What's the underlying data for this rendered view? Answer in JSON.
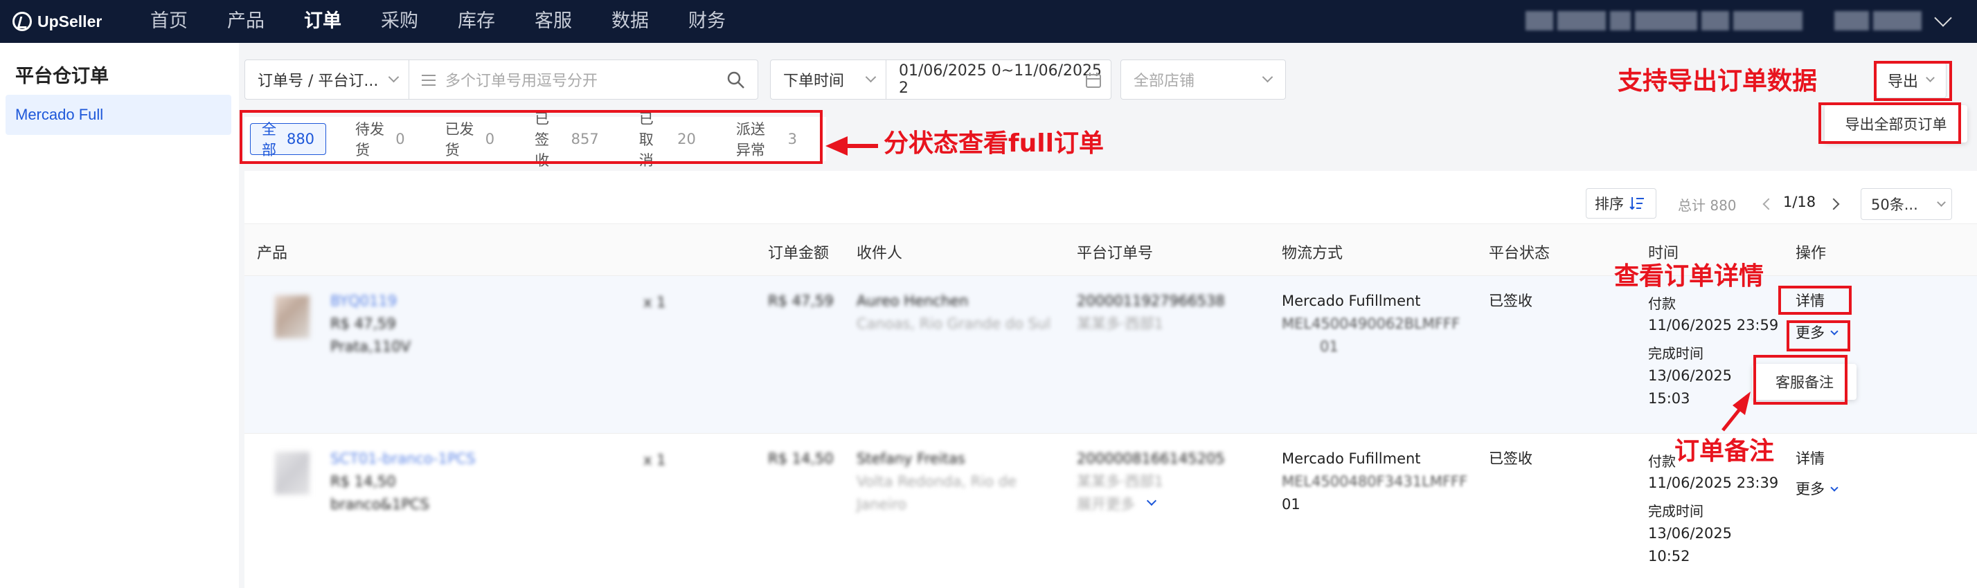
{
  "app": {
    "logo": "UpSeller",
    "menu": [
      "首页",
      "产品",
      "订单",
      "采购",
      "库存",
      "客服",
      "数据",
      "财务"
    ],
    "active": "订单"
  },
  "sidebar": {
    "title": "平台仓订单",
    "item": "Mercado Full"
  },
  "filters": {
    "order_type": "订单号 / 平台订...",
    "order_placeholder": "多个订单号用逗号分开",
    "time_type": "下单时间",
    "date_range": "01/06/2025 0~11/06/2025 2",
    "store_placeholder": "全部店铺",
    "export": "导出",
    "export_all": "导出全部页订单"
  },
  "tabs": [
    {
      "label": "全部",
      "count": "880"
    },
    {
      "label": "待发货",
      "count": "0"
    },
    {
      "label": "已发货",
      "count": "0"
    },
    {
      "label": "已签收",
      "count": "857"
    },
    {
      "label": "已取消",
      "count": "20"
    },
    {
      "label": "派送异常",
      "count": "3"
    }
  ],
  "toolbar": {
    "sort": "排序",
    "total": "总计 880",
    "page": "1/18",
    "page_size": "50条..."
  },
  "columns": [
    "产品",
    "订单金额",
    "收件人",
    "平台订单号",
    "物流方式",
    "平台状态",
    "时间",
    "操作"
  ],
  "rows": [
    {
      "sku": "BYQ0119",
      "price": "R$ 47,59",
      "variant": "Prata,110V",
      "qty": "x 1",
      "amount": "R$ 47,59",
      "name": "Aureo Henchen",
      "city": "Canoas, Rio Grande do Sul",
      "order_no": "2000011927966538",
      "order_sub": "某某多·西部1",
      "logistics": "Mercado Fufillment",
      "tracking": [
        "MEL4500490062BLMFFF",
        "01"
      ],
      "status": "已签收",
      "pay_label": "付款",
      "pay_time": "11/06/2025 23:59",
      "done_label": "完成时间",
      "done_date": "13/06/2025",
      "done_time": "15:03",
      "detail": "详情",
      "more": "更多",
      "note_menu": "客服备注"
    },
    {
      "sku": "SCT01-branco-1PCS",
      "price": "R$ 14,50",
      "variant": "branco&1PCS",
      "qty": "x 1",
      "amount": "R$ 14,50",
      "name": "Stefany Freitas",
      "city_lines": [
        "Volta Redonda, Rio de",
        "Janeiro"
      ],
      "order_no": "2000008166145205",
      "order_sub": "某某多·西部1",
      "order_more": "展开更多",
      "logistics": "Mercado Fufillment",
      "tracking": [
        "MEL4500480F3431LMFFF",
        "01"
      ],
      "status": "已签收",
      "pay_label": "付款",
      "pay_time": "11/06/2025 23:39",
      "done_label": "完成时间",
      "done_date": "13/06/2025",
      "done_time": "10:52",
      "detail": "详情",
      "more": "更多"
    }
  ],
  "annotations": {
    "export": "支持导出订单数据",
    "tabs": "分状态查看full订单",
    "detail": "查看订单详情",
    "note": "订单备注"
  }
}
